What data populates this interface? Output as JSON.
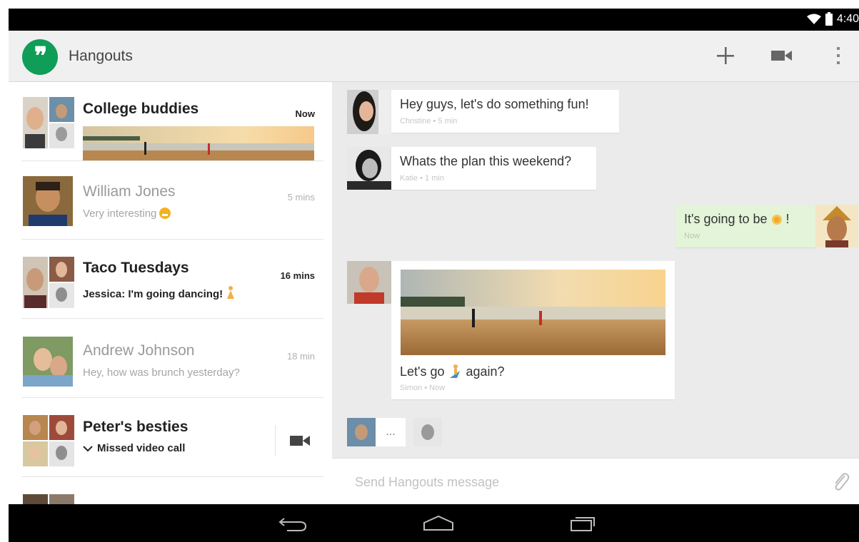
{
  "status_bar": {
    "time": "4:40"
  },
  "action_bar": {
    "title": "Hangouts",
    "actions": [
      "add-icon",
      "video-camera-icon",
      "overflow-menu-icon"
    ]
  },
  "conversations": [
    {
      "name": "College buddies",
      "time": "Now",
      "snippet": "",
      "has_photo": true,
      "unread": true
    },
    {
      "name": "William Jones",
      "time": "5 mins",
      "snippet": "Very interesting",
      "snippet_emoji": "smiley-emoji-icon",
      "unread": false
    },
    {
      "name": "Taco Tuesdays",
      "time": "16 mins",
      "snippet": "Jessica: I'm going dancing!",
      "snippet_emoji": "dancer-emoji-icon",
      "unread": true
    },
    {
      "name": "Andrew Johnson",
      "time": "18 min",
      "snippet": "Hey, how was brunch yesterday?",
      "unread": false
    },
    {
      "name": "Peter's besties",
      "snippet": "Missed video call",
      "action_icon": "video-camera-icon",
      "unread": true
    }
  ],
  "messages": [
    {
      "text": "Hey guys, let's do something fun!",
      "meta": "Christine • 5 min"
    },
    {
      "text": "Whats the plan this weekend?",
      "meta": "Katie • 1 min"
    },
    {
      "text": "It's going to be",
      "text_end": "!",
      "emoji": "sun-emoji-icon",
      "meta": "Now",
      "outgoing": true
    },
    {
      "text": "Let's go",
      "text_end": "again?",
      "emoji": "surfer-emoji-icon",
      "meta": "Simon • Now",
      "has_photo": true
    }
  ],
  "typing": {
    "indicator": "..."
  },
  "composer": {
    "placeholder": "Send Hangouts message"
  },
  "colors": {
    "accent": "#0f9d58",
    "outgoing_bubble": "#e3f4d9",
    "background": "#ebebeb"
  }
}
